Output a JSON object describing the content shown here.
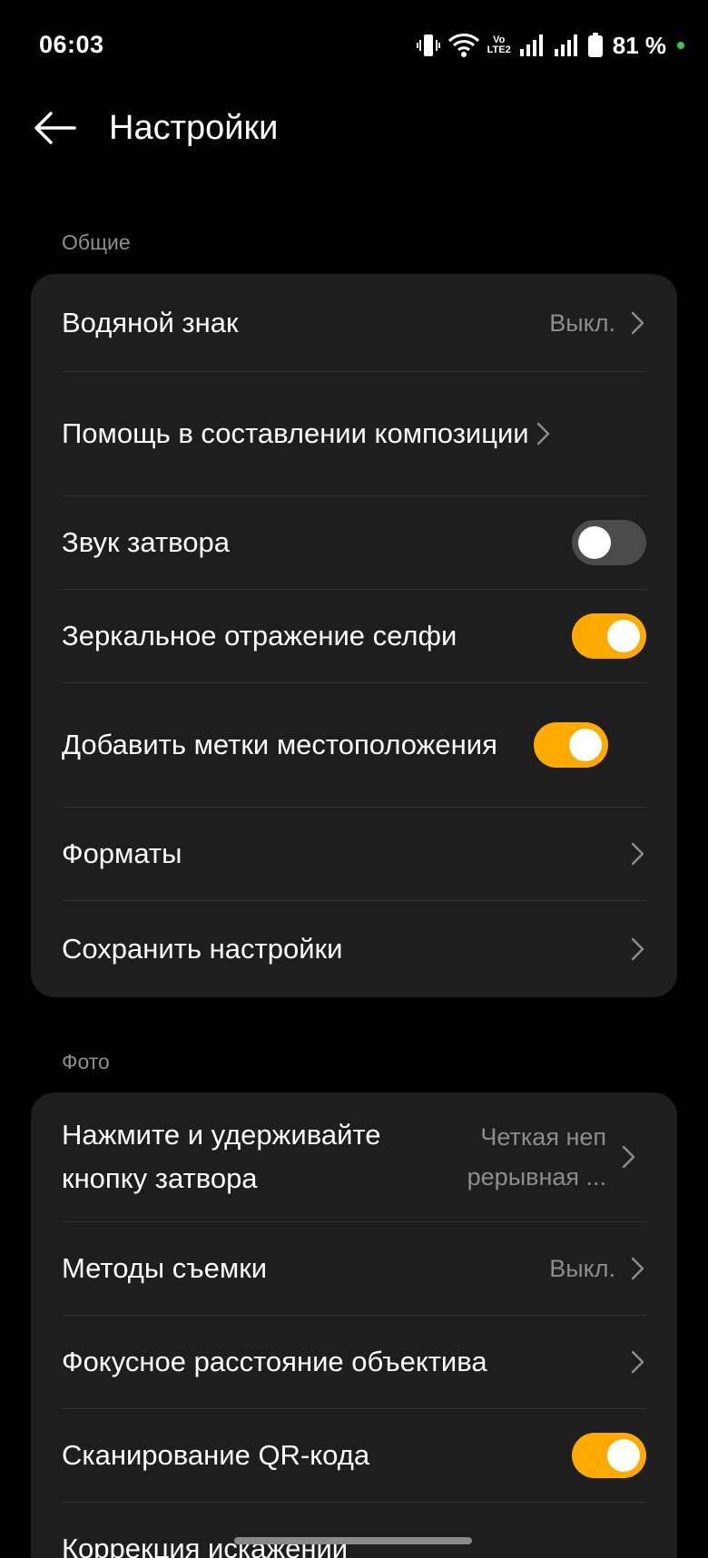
{
  "status_bar": {
    "time": "06:03",
    "volte_top": "Vo",
    "volte_bottom": "LTE2",
    "battery_percent": "81 %",
    "icons": [
      "vibrate-icon",
      "wifi-icon",
      "volte-icon",
      "signal-icon",
      "signal-icon",
      "battery-icon"
    ]
  },
  "header": {
    "back_icon": "arrow-left-icon",
    "title": "Настройки"
  },
  "sections": {
    "general": {
      "label": "Общие",
      "rows": [
        {
          "label": "Водяной знак",
          "value": "Выкл.",
          "type": "nav"
        },
        {
          "label": "Помощь в составлении композиции",
          "type": "nav"
        },
        {
          "label": "Звук затвора",
          "type": "toggle",
          "on": false
        },
        {
          "label": "Зеркальное отражение селфи",
          "type": "toggle",
          "on": true
        },
        {
          "label": "Добавить метки местоположения",
          "type": "toggle",
          "on": true
        },
        {
          "label": "Форматы",
          "type": "nav"
        },
        {
          "label": "Сохранить настройки",
          "type": "nav"
        }
      ]
    },
    "photo": {
      "label": "Фото",
      "rows": [
        {
          "label": "Нажмите и удерживайте кнопку затвора",
          "value": "Четкая неп рерывная ...",
          "type": "nav"
        },
        {
          "label": "Методы съемки",
          "value": "Выкл.",
          "type": "nav"
        },
        {
          "label": "Фокусное расстояние объектива",
          "type": "nav"
        },
        {
          "label": "Сканирование QR-кода",
          "type": "toggle",
          "on": true
        },
        {
          "label": "Коррекция искажений",
          "type": "nav"
        }
      ]
    }
  },
  "colors": {
    "background": "#000000",
    "card": "#1e1e1e",
    "accent_toggle_on": "#ffaa00",
    "toggle_off": "#4b4b4b",
    "secondary_text": "#8d8d8d"
  }
}
